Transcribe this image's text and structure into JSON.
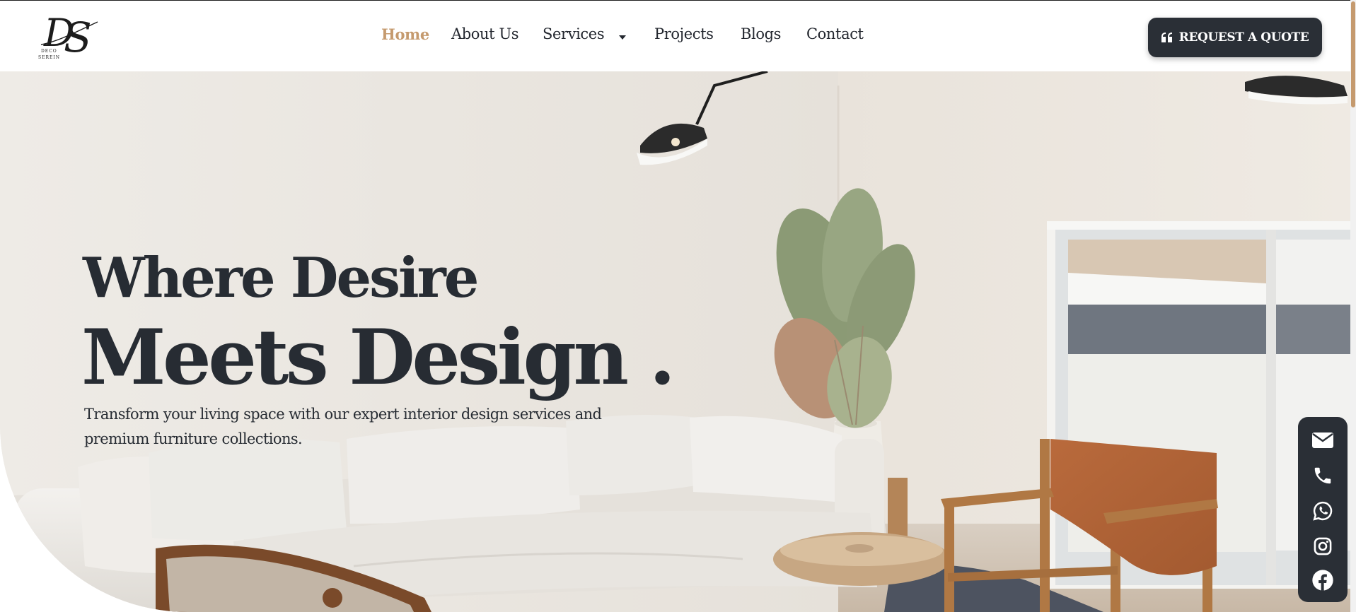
{
  "brand": {
    "logo_name": "Deco Serein",
    "logo_monogram": "DS",
    "logo_text": "DECO SEREIN"
  },
  "nav": {
    "items": [
      {
        "label": "Home",
        "active": true
      },
      {
        "label": "About Us"
      },
      {
        "label": "Services",
        "has_dropdown": true
      },
      {
        "label": "Projects"
      },
      {
        "label": "Blogs"
      },
      {
        "label": "Contact"
      }
    ]
  },
  "header": {
    "cta_label": "REQUEST A QUOTE",
    "cta_icon": "quote-icon"
  },
  "hero": {
    "title_line1": "Where Desire",
    "title_line2": "Meets Design .",
    "subtitle": "Transform your living space with our expert interior design services and premium furniture collections."
  },
  "social": [
    {
      "name": "email",
      "icon": "envelope-icon"
    },
    {
      "name": "phone",
      "icon": "phone-icon"
    },
    {
      "name": "whatsapp",
      "icon": "whatsapp-icon"
    },
    {
      "name": "instagram",
      "icon": "instagram-icon"
    },
    {
      "name": "facebook",
      "icon": "facebook-icon"
    }
  ],
  "colors": {
    "accent": "#c59a6e",
    "dark": "#2a2f36",
    "text": "#272c33",
    "background": "#ffffff"
  }
}
